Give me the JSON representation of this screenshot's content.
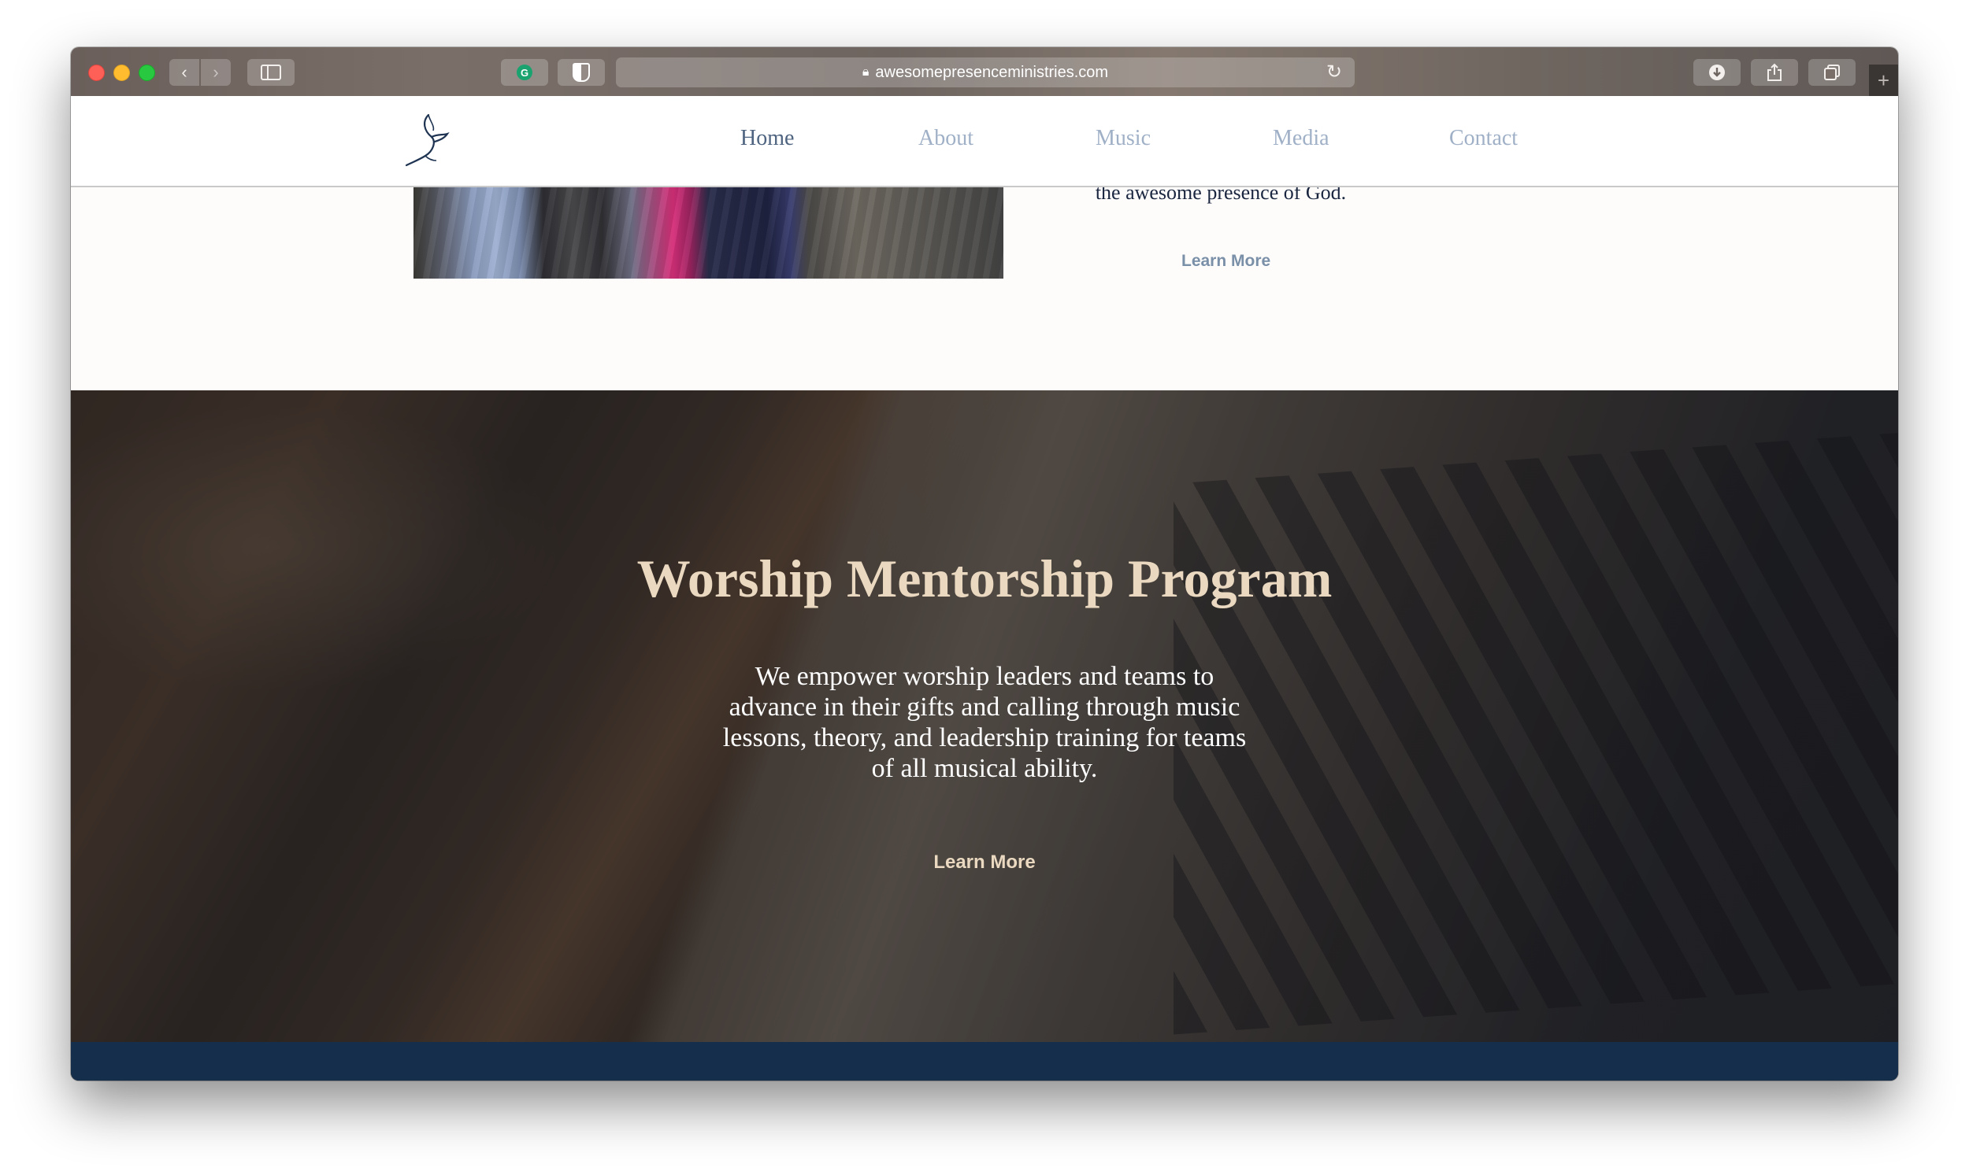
{
  "browser": {
    "url": "awesomepresenceministries.com",
    "icons": {
      "back": "chevron-left-icon",
      "forward": "chevron-right-icon",
      "sidebar": "sidebar-icon",
      "lock": "lock-icon",
      "reload": "reload-icon",
      "download": "download-icon",
      "share": "share-icon",
      "tabs": "tabs-icon",
      "new_tab": "plus-icon"
    }
  },
  "site": {
    "nav": [
      {
        "label": "Home",
        "active": true
      },
      {
        "label": "About",
        "active": false
      },
      {
        "label": "Music",
        "active": false
      },
      {
        "label": "Media",
        "active": false
      },
      {
        "label": "Contact",
        "active": false
      }
    ],
    "colors": {
      "nav_active": "#4f6480",
      "nav_inactive": "#9fb0c7",
      "hero_title": "#ead9c0",
      "footer": "#152e4b"
    }
  },
  "upper": {
    "text_tail": "the awesome presence of God.",
    "learn_more": "Learn More"
  },
  "hero": {
    "title": "Worship Mentorship Program",
    "description": "We empower worship leaders and teams to advance in their gifts and calling through music lessons, theory, and leadership training for teams of all musical ability.",
    "learn_more": "Learn More"
  }
}
